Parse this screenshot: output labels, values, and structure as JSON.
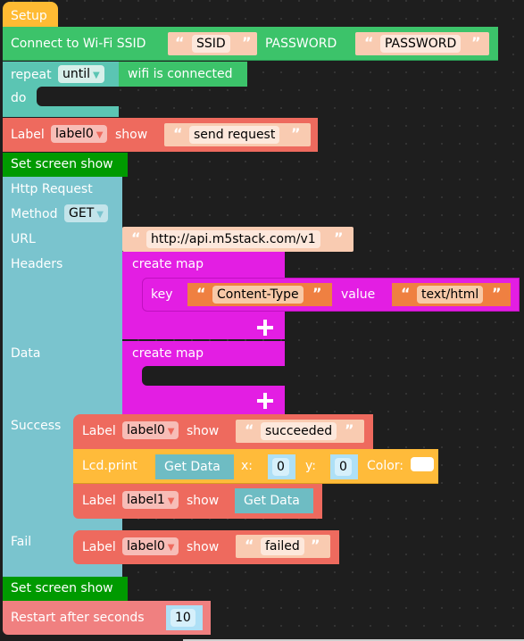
{
  "colors": {
    "setup": "#ffbb33",
    "wifi": "#3cc36a",
    "repeat": "#5bc5b3",
    "label": "#ee6a5e",
    "screen": "#009a00",
    "http": "#7ac4ce",
    "map": "#e31ee3",
    "text": "#f9cbb1",
    "textOrange": "#ef8041",
    "lcd": "#ffbb3a",
    "getData": "#6ebcc3",
    "number": "#aee0f6",
    "restart": "#f08080"
  },
  "setup": {
    "label": "Setup"
  },
  "wifi": {
    "label": "Connect to Wi-Fi SSID",
    "ssid_value": "SSID",
    "password_label": "PASSWORD",
    "password_value": "PASSWORD"
  },
  "repeat": {
    "label": "repeat",
    "mode": "until",
    "condition": "wifi is connected",
    "do_label": "do"
  },
  "label_send": {
    "label": "Label",
    "target": "label0",
    "show": "show",
    "text": "send request"
  },
  "screen1": {
    "label": "Set screen show"
  },
  "http": {
    "title": "Http Request",
    "method_label": "Method",
    "method_value": "GET",
    "url_label": "URL",
    "url_value": "http://api.m5stack.com/v1",
    "headers_label": "Headers",
    "data_label": "Data",
    "success_label": "Success",
    "fail_label": "Fail"
  },
  "headers_map": {
    "label": "create map",
    "key_label": "key",
    "key_value": "Content-Type",
    "value_label": "value",
    "value_value": "text/html"
  },
  "data_map": {
    "label": "create map"
  },
  "success": {
    "label0": {
      "label": "Label",
      "target": "label0",
      "show": "show",
      "text": "succeeded"
    },
    "lcd": {
      "label": "Lcd.print",
      "data": "Get Data",
      "x_label": "x:",
      "x_value": "0",
      "y_label": "y:",
      "y_value": "0",
      "color_label": "Color:",
      "color_value": "#ffffff"
    },
    "label1": {
      "label": "Label",
      "target": "label1",
      "show": "show",
      "data": "Get Data"
    }
  },
  "fail": {
    "label0": {
      "label": "Label",
      "target": "label0",
      "show": "show",
      "text": "failed"
    }
  },
  "screen2": {
    "label": "Set screen show"
  },
  "restart": {
    "label": "Restart after seconds",
    "value": "10"
  },
  "quotes": {
    "open": "“",
    "close": "”"
  }
}
